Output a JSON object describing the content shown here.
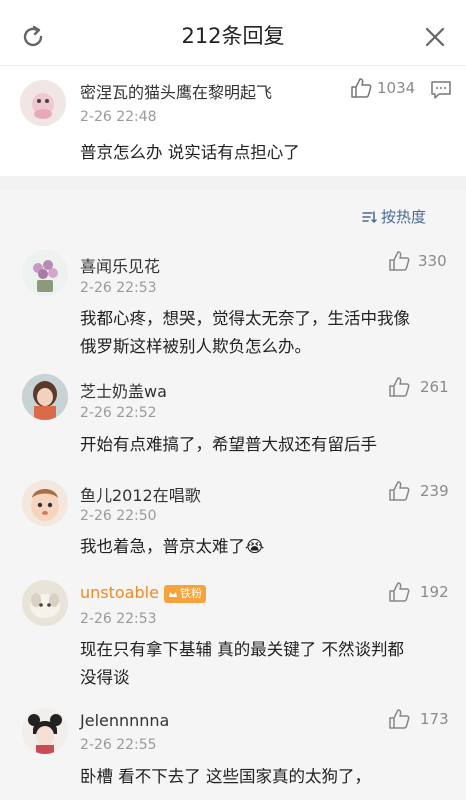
{
  "header": {
    "title": "212条回复"
  },
  "root": {
    "name": "密涅瓦的猫头鹰在黎明起飞",
    "time": "2-26 22:48",
    "likes": "1034",
    "text": "普京怎么办 说实话有点担心了"
  },
  "sort": {
    "label": "按热度"
  },
  "replies": [
    {
      "name": "喜闻乐见花",
      "time": "2-26 22:53",
      "likes": "330",
      "lines": [
        "我都心疼，想哭，觉得太无奈了，生活中我像",
        "俄罗斯这样被别人欺负怎么办。"
      ]
    },
    {
      "name": "芝士奶盖wa",
      "time": "2-26 22:52",
      "likes": "261",
      "lines": [
        "开始有点难搞了，希望普大叔还有留后手"
      ]
    },
    {
      "name": "鱼儿2012在唱歌",
      "time": "2-26 22:50",
      "likes": "239",
      "lines": [
        "我也着急，普京太难了😭"
      ]
    },
    {
      "name": "unstoable",
      "badge": "铁粉",
      "time": "2-26 22:53",
      "likes": "192",
      "lines": [
        "现在只有拿下基辅 真的最关键了 不然谈判都",
        "没得谈"
      ]
    },
    {
      "name": "Jelennnnna",
      "time": "2-26 22:55",
      "likes": "173",
      "lines": [
        "卧槽 看不下去了 这些国家真的太狗了，"
      ]
    }
  ],
  "colors": {
    "accent": "#4a6a99",
    "vip_name": "#f08a24",
    "badge": "#f6a33b"
  }
}
